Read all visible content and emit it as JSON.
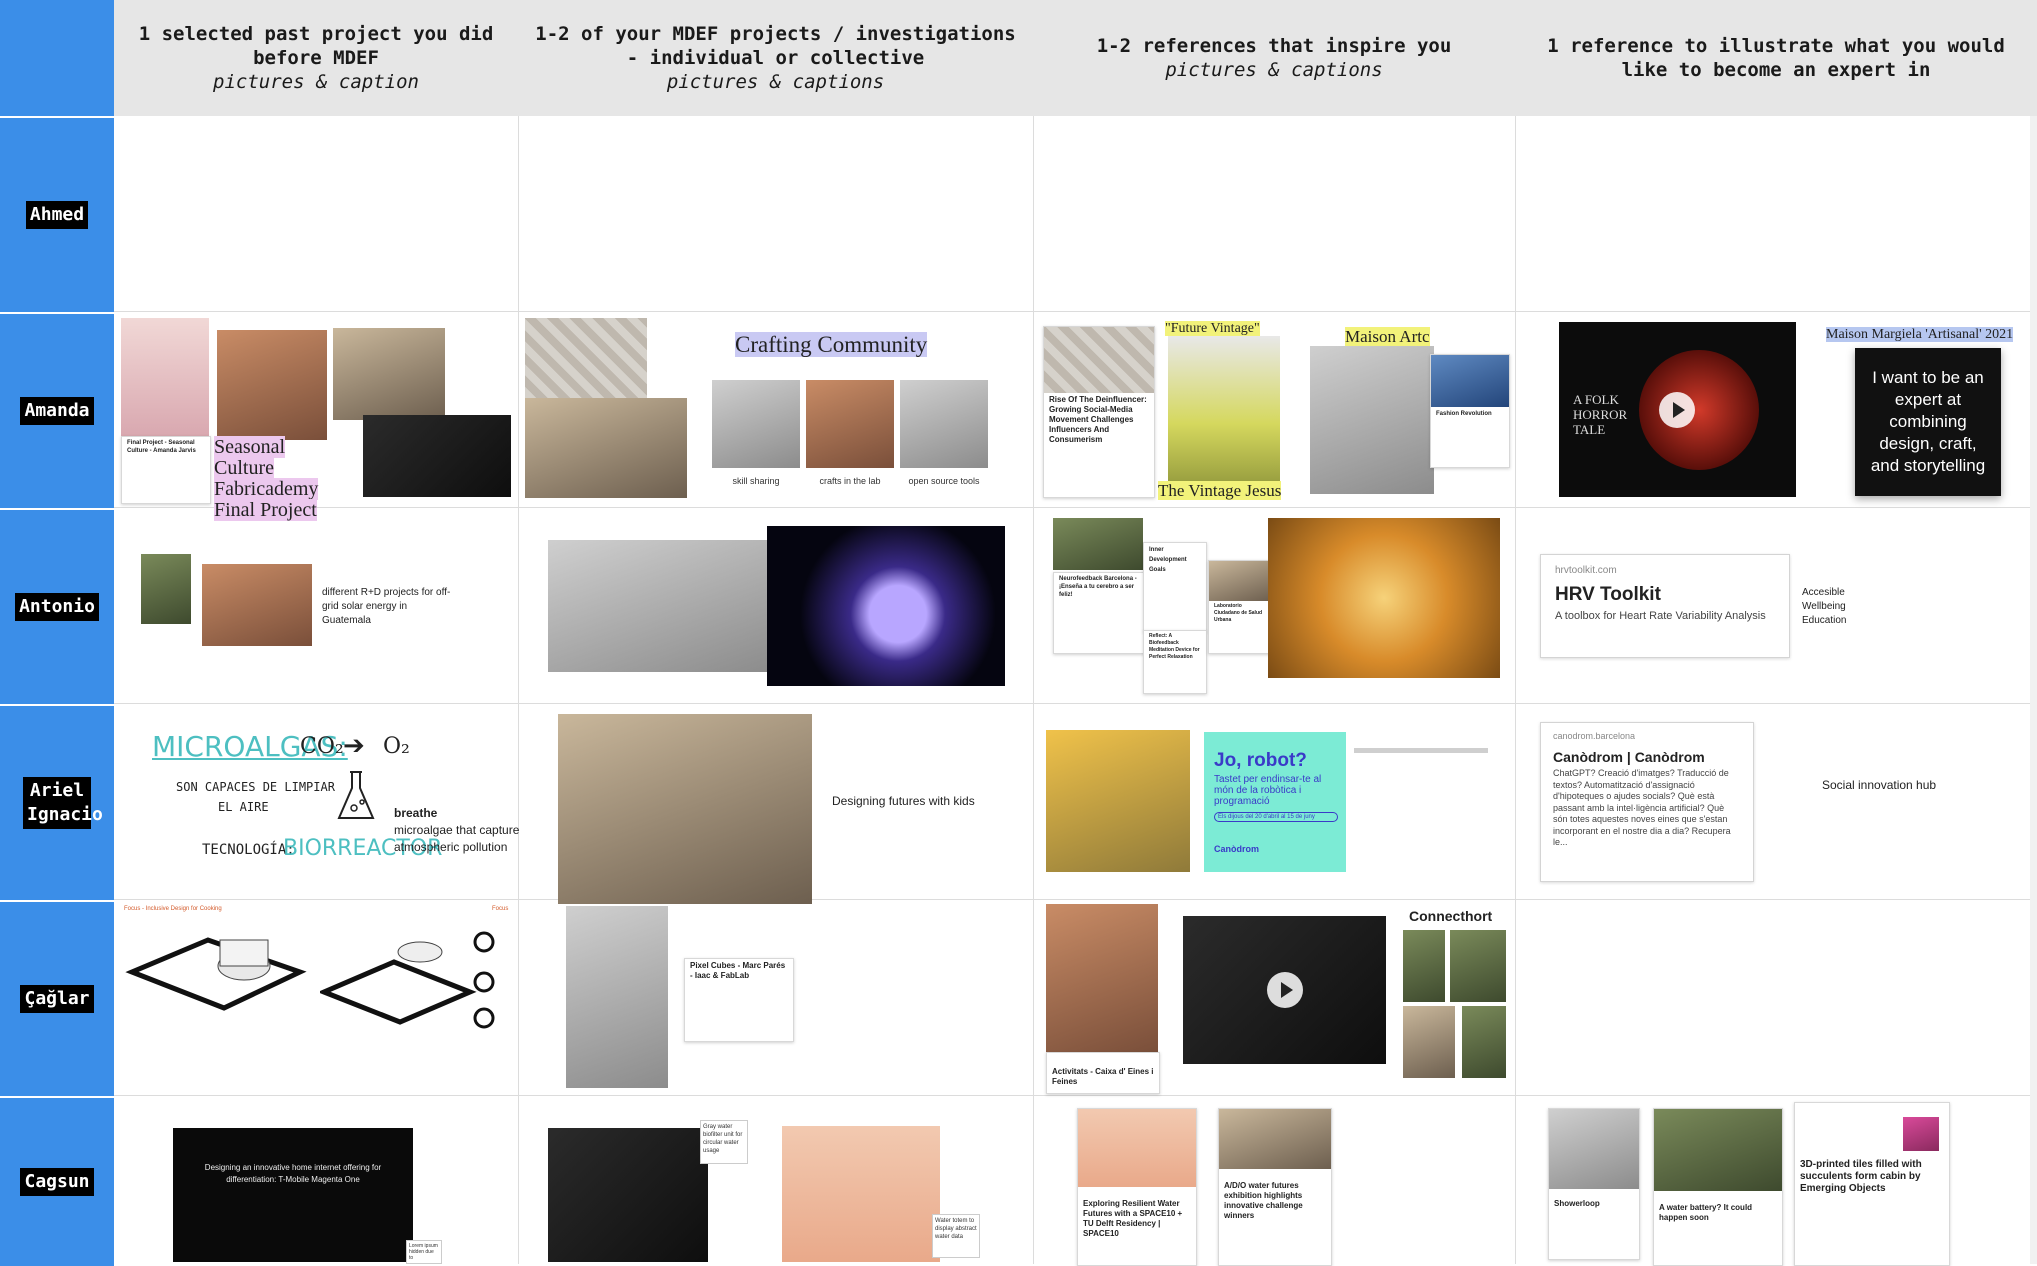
{
  "columns": [
    {
      "title": "1 selected past project you did before MDEF",
      "sub": "pictures & caption"
    },
    {
      "title": "1-2 of your MDEF projects / investigations - individual or collective",
      "sub": "pictures & captions"
    },
    {
      "title": "1-2 references that inspire you",
      "sub": "pictures & captions"
    },
    {
      "title": "1 reference to illustrate what you would like to become an expert in",
      "sub": ""
    }
  ],
  "rows": [
    "Ahmed",
    "Amanda",
    "Antonio",
    "Ariel Ignacio",
    "Çağlar",
    "Cagsun"
  ],
  "amanda": {
    "past_card_title": "Final Project - Seasonal Culture - Amanda Jarvis",
    "past_label": "Seasonal Culture Fabricademy Final Project",
    "mdef_title": "Crafting Community",
    "mdef_captions": [
      "skill sharing",
      "crafts in the lab",
      "open source tools"
    ],
    "ref_card_title": "Rise Of The Deinfluencer: Growing Social-Media Movement Challenges Influencers And Consumerism",
    "ref_label_top": "\"Future Vintage\"",
    "ref_label_bottom": "The Vintage Jesus",
    "ref_label_maison": "Maison Artc",
    "ref_card2_title": "Fashion Revolution",
    "expert_label": "Maison Margiela 'Artisanal' 2021",
    "expert_video_title": "A FOLK HORROR TALE",
    "expert_sticky": "I want to be an expert at combining design, craft, and storytelling"
  },
  "antonio": {
    "past_caption": "different R+D projects for off-grid solar energy in Guatemala",
    "ref_card1_title": "Neurofeedback Barcelona - ¡Enseña a tu cerebro a ser feliz!",
    "ref_card2_title": "Inner Development Goals",
    "ref_card3_title": "Laboratorio Ciudadano de Salud Urbana",
    "ref_card4_title": "Reflect: A Biofeedback Meditation Device for Perfect Relaxation",
    "expert_card_src": "hrvtoolkit.com",
    "expert_card_title": "HRV Toolkit",
    "expert_card_desc": "A toolbox for Heart Rate Variability Analysis",
    "expert_note": "Accesible Wellbeing Education"
  },
  "ariel": {
    "past_heading": "MICROALGAS:",
    "past_formula_left": "CO₂",
    "past_formula_right": "O₂",
    "past_line1": "SON CAPACES DE LIMPIAR",
    "past_line2": "EL AIRE",
    "past_tech_label": "TECNOLOGÍA:",
    "past_tech_value": "BIORREACTOR",
    "past_caption_title": "breathe",
    "past_caption": "microalgae that capture atmospheric pollution",
    "mdef_caption": "Designing futures with kids",
    "ref_poster_title": "Jo, robot?",
    "ref_poster_sub": "Tastet per endinsar-te al món de la robòtica i programació",
    "ref_poster_date": "Els dijous del 20 d'abril al 15 de juny",
    "ref_poster_brand": "Canòdrom",
    "expert_card_src": "canodrom.barcelona",
    "expert_card_title": "Canòdrom | Canòdrom",
    "expert_card_desc": "ChatGPT? Creació d'imatges? Traducció de textos? Automatització d'assignació d'hipoteques o ajudes socials? Què està passant amb la intel·ligència artificial? Què són totes aquestes noves eines que s'estan incorporant en el nostre dia a dia? Recupera le...",
    "expert_note": "Social innovation hub"
  },
  "caglar": {
    "past_label_left": "Focus - Inclusive Design for Cooking",
    "past_label_right": "Focus",
    "mdef_card_title": "Pixel Cubes - Marc Parés - Iaac & FabLab",
    "ref_card_title": "Activitats - Caixa d' Eines i Feines",
    "ref_title": "Connecthort"
  },
  "cagsun": {
    "past_title": "Designing an innovative home internet offering for differentiation: T-Mobile Magenta One",
    "past_note": "Lorem ipsum hidden due to",
    "mdef_note1": "Gray water biofilter unit for circular water usage",
    "mdef_note2": "Water totem to display abstract water data",
    "ref_card1_title": "Exploring Resilient Water Futures with a SPACE10 + TU Delft Residency | SPACE10",
    "ref_card2_title": "A/D/O water futures exhibition highlights innovative challenge winners",
    "expert_card1_title": "Showerloop",
    "expert_card2_title": "A water battery? It could happen soon",
    "expert_card3_title": "3D-printed tiles filled with succulents form cabin by Emerging Objects"
  }
}
